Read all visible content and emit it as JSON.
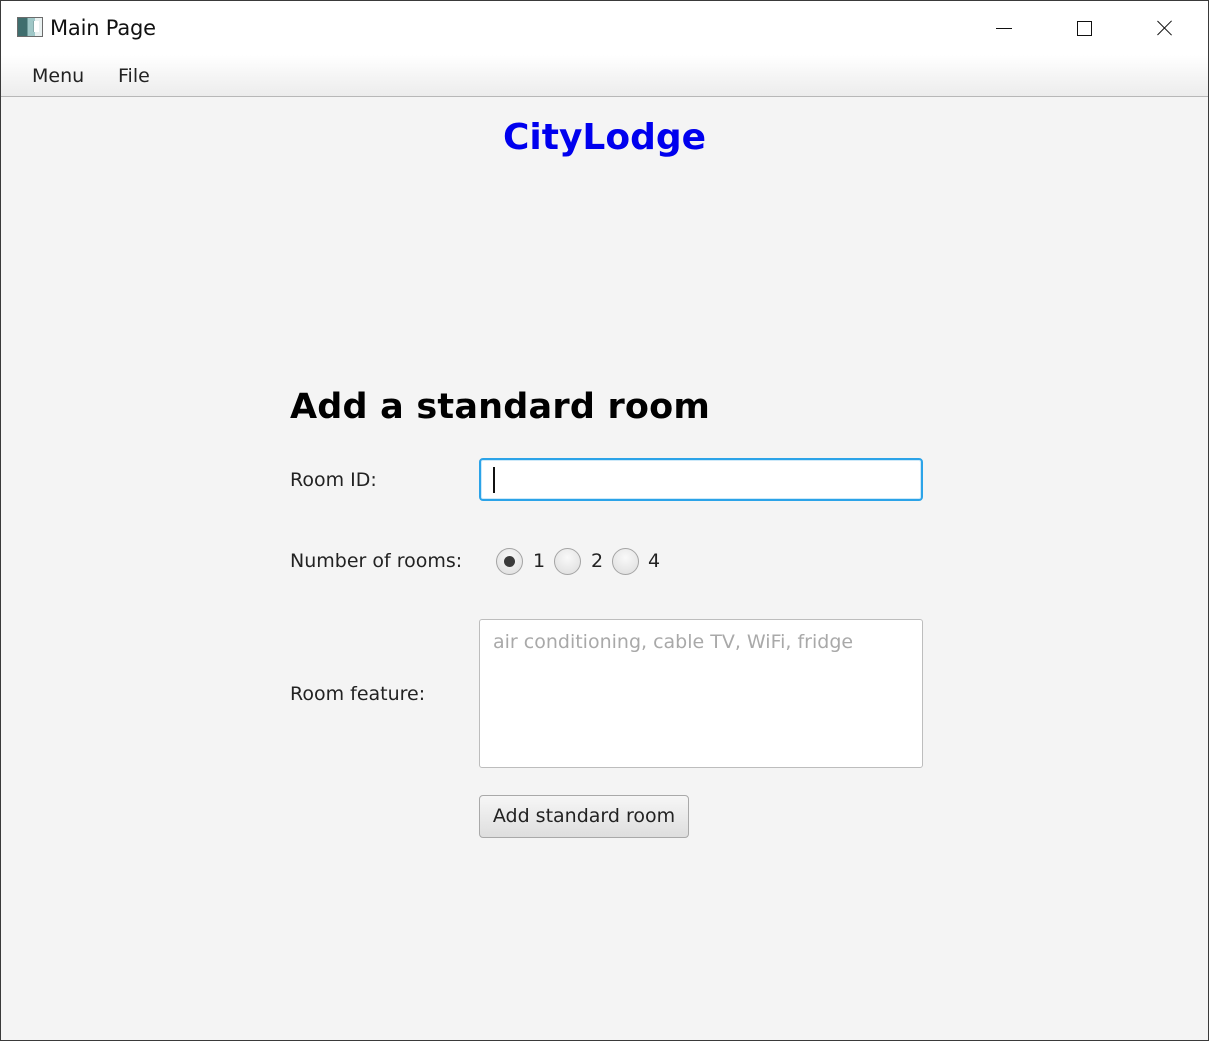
{
  "window": {
    "title": "Main Page",
    "app_icon": "java-app-icon",
    "controls": {
      "minimize": "minimize-icon",
      "maximize": "maximize-icon",
      "close": "close-icon"
    }
  },
  "menubar": {
    "items": [
      {
        "label": "Menu"
      },
      {
        "label": "File"
      }
    ]
  },
  "header": {
    "brand": "CityLodge",
    "brand_color": "#0000ee"
  },
  "form": {
    "title": "Add a standard room",
    "room_id": {
      "label": "Room ID:",
      "value": ""
    },
    "number_of_rooms": {
      "label": "Number of rooms:",
      "options": [
        {
          "label": "1",
          "selected": true
        },
        {
          "label": "2",
          "selected": false
        },
        {
          "label": "4",
          "selected": false
        }
      ]
    },
    "room_feature": {
      "label": "Room feature:",
      "placeholder": "air conditioning, cable TV, WiFi, fridge",
      "value": ""
    },
    "submit_label": "Add standard room"
  },
  "colors": {
    "focus_border": "#2ba3e8",
    "background": "#f4f4f4"
  }
}
